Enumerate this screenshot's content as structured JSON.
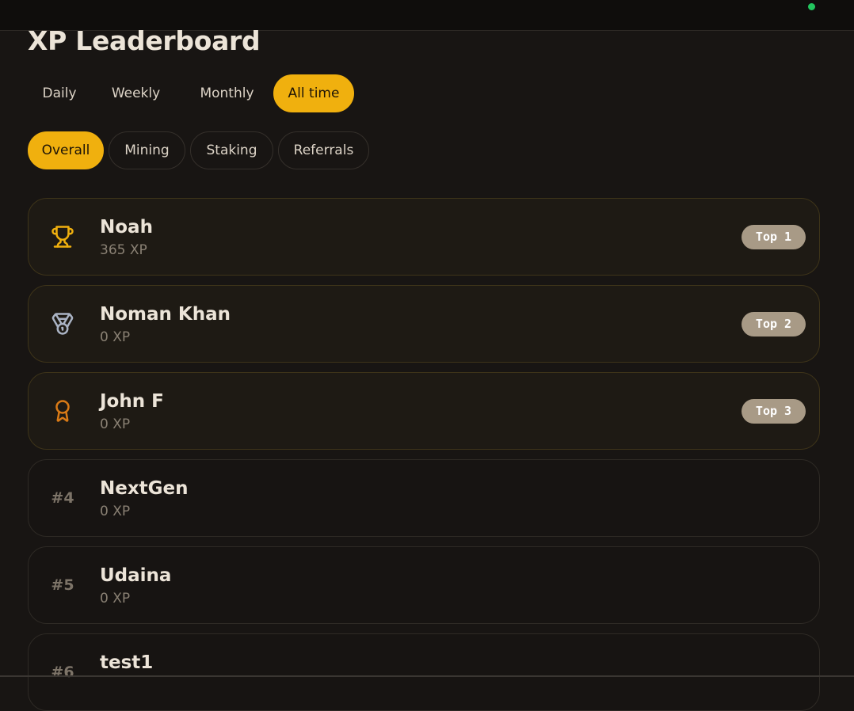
{
  "page": {
    "title": "XP Leaderboard"
  },
  "period_tabs": [
    {
      "label": "Daily",
      "active": false
    },
    {
      "label": "Weekly",
      "active": false
    },
    {
      "label": "Monthly",
      "active": false
    },
    {
      "label": "All time",
      "active": true
    }
  ],
  "category_tabs": [
    {
      "label": "Overall",
      "active": true
    },
    {
      "label": "Mining",
      "active": false
    },
    {
      "label": "Staking",
      "active": false
    },
    {
      "label": "Referrals",
      "active": false
    }
  ],
  "leaderboard": [
    {
      "name": "Noah",
      "xp": "365 XP",
      "badge": "Top 1",
      "icon": "trophy-icon"
    },
    {
      "name": "Noman Khan",
      "xp": "0 XP",
      "badge": "Top 2",
      "icon": "medal-icon"
    },
    {
      "name": "John F",
      "xp": "0 XP",
      "badge": "Top 3",
      "icon": "award-ribbon-icon"
    },
    {
      "name": "NextGen",
      "xp": "0 XP",
      "rank": "#4"
    },
    {
      "name": "Udaina",
      "xp": "0 XP",
      "rank": "#5"
    },
    {
      "name": "test1",
      "rank": "#6"
    }
  ],
  "colors": {
    "accent": "#f0b00e",
    "gold": "#f0b00e",
    "silver": "#aab3c4",
    "bronze": "#d97a16",
    "status": "#22c55e"
  }
}
